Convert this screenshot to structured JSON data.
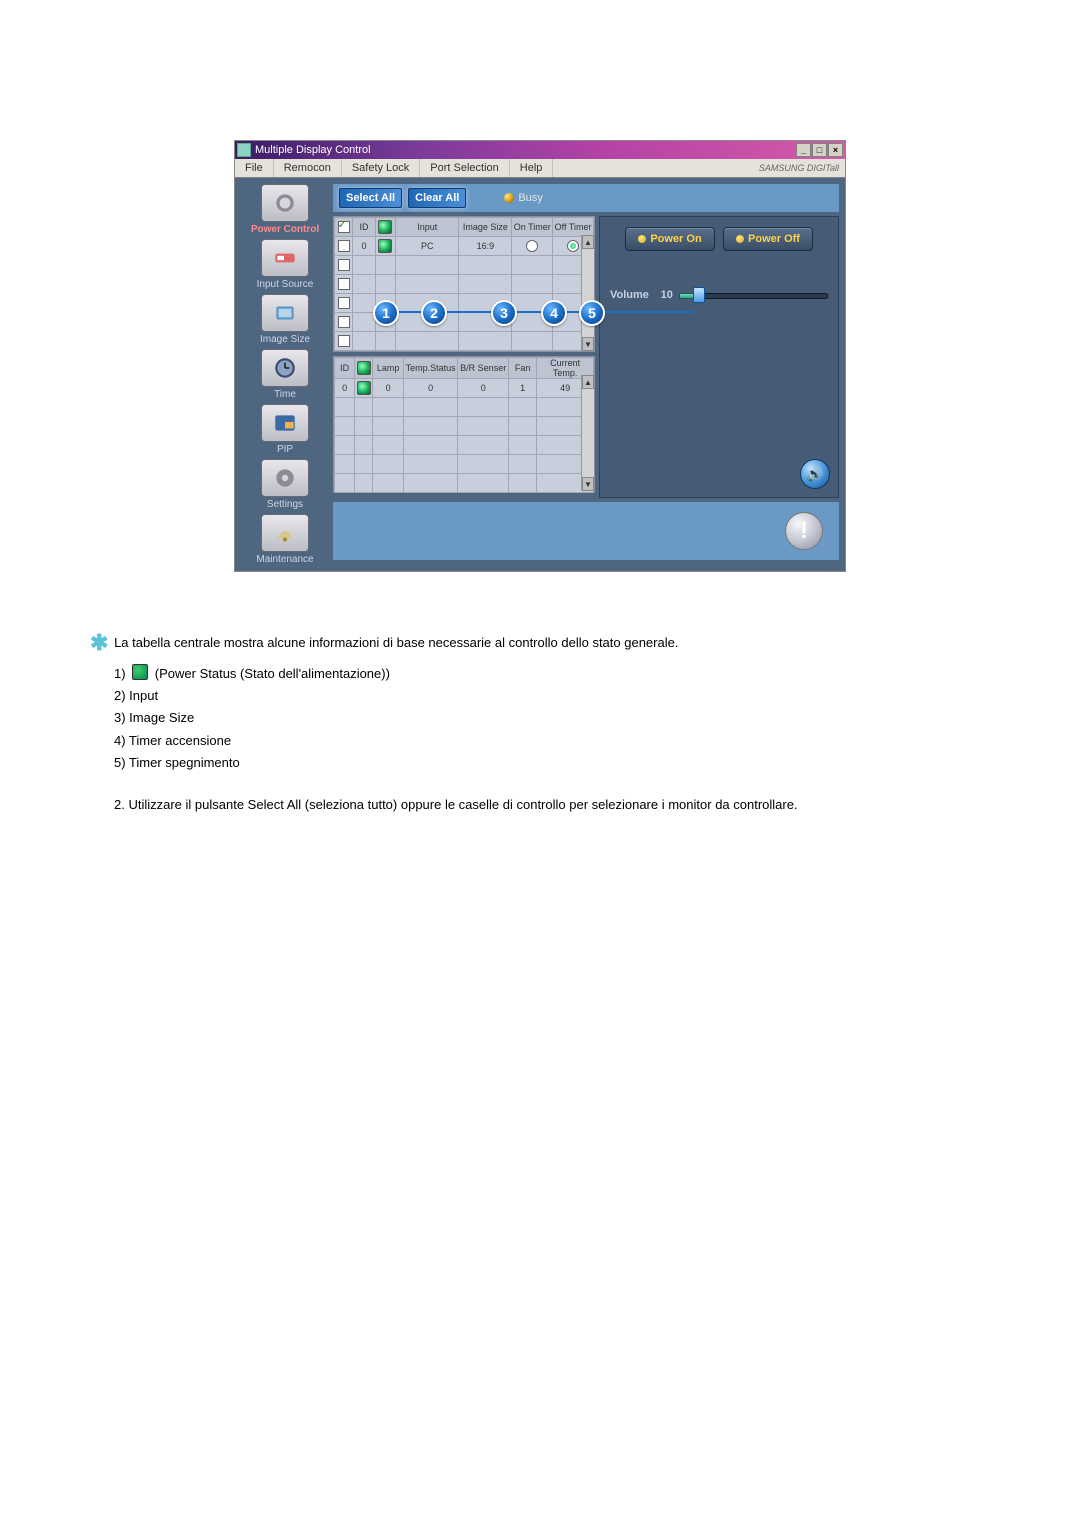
{
  "window": {
    "title": "Multiple Display Control",
    "brand": "SAMSUNG DIGITall"
  },
  "menubar": {
    "items": [
      "File",
      "Remocon",
      "Safety Lock",
      "Port Selection",
      "Help"
    ]
  },
  "sidebar": {
    "items": [
      {
        "label": "Power Control",
        "active": true
      },
      {
        "label": "Input Source"
      },
      {
        "label": "Image Size"
      },
      {
        "label": "Time"
      },
      {
        "label": "PIP"
      },
      {
        "label": "Settings"
      },
      {
        "label": "Maintenance"
      }
    ]
  },
  "toolbar": {
    "select_all": "Select All",
    "clear_all": "Clear All",
    "busy": "Busy"
  },
  "table_main": {
    "headers": {
      "chk": "",
      "id": "ID",
      "power": "",
      "input": "Input",
      "image_size": "Image Size",
      "on_timer": "On Timer",
      "off_timer": "Off Timer"
    },
    "rows": [
      {
        "checked": true,
        "id": "0",
        "power": "on",
        "input": "PC",
        "image_size": "16:9",
        "on_timer": "off",
        "off_timer": "on"
      },
      {
        "checked": false
      },
      {
        "checked": false
      },
      {
        "checked": false
      },
      {
        "checked": false
      },
      {
        "checked": false
      }
    ]
  },
  "table_status": {
    "headers": {
      "id": "ID",
      "power": "",
      "lamp": "Lamp",
      "temp_status": "Temp.Status",
      "br_sensor": "B/R Senser",
      "fan": "Fan",
      "cur_temp": "Current Temp."
    },
    "rows": [
      {
        "id": "0",
        "power": "on",
        "lamp": "0",
        "temp_status": "0",
        "br_sensor": "0",
        "fan": "1",
        "cur_temp": "49"
      },
      {},
      {},
      {},
      {},
      {}
    ]
  },
  "callouts": [
    "1",
    "2",
    "3",
    "4",
    "5"
  ],
  "right": {
    "power_on": "Power On",
    "power_off": "Power Off",
    "volume_label": "Volume",
    "volume_value": "10"
  },
  "description": {
    "intro": "La tabella centrale mostra alcune informazioni di base necessarie al controllo dello stato generale.",
    "list": [
      "1)   (Power Status (Stato dell'alimentazione))",
      "2) Input",
      "3) Image Size",
      "4) Timer accensione",
      "5) Timer spegnimento"
    ],
    "note2": "2.   Utilizzare il pulsante Select All (seleziona tutto) oppure le caselle di controllo per selezionare i monitor da controllare."
  }
}
